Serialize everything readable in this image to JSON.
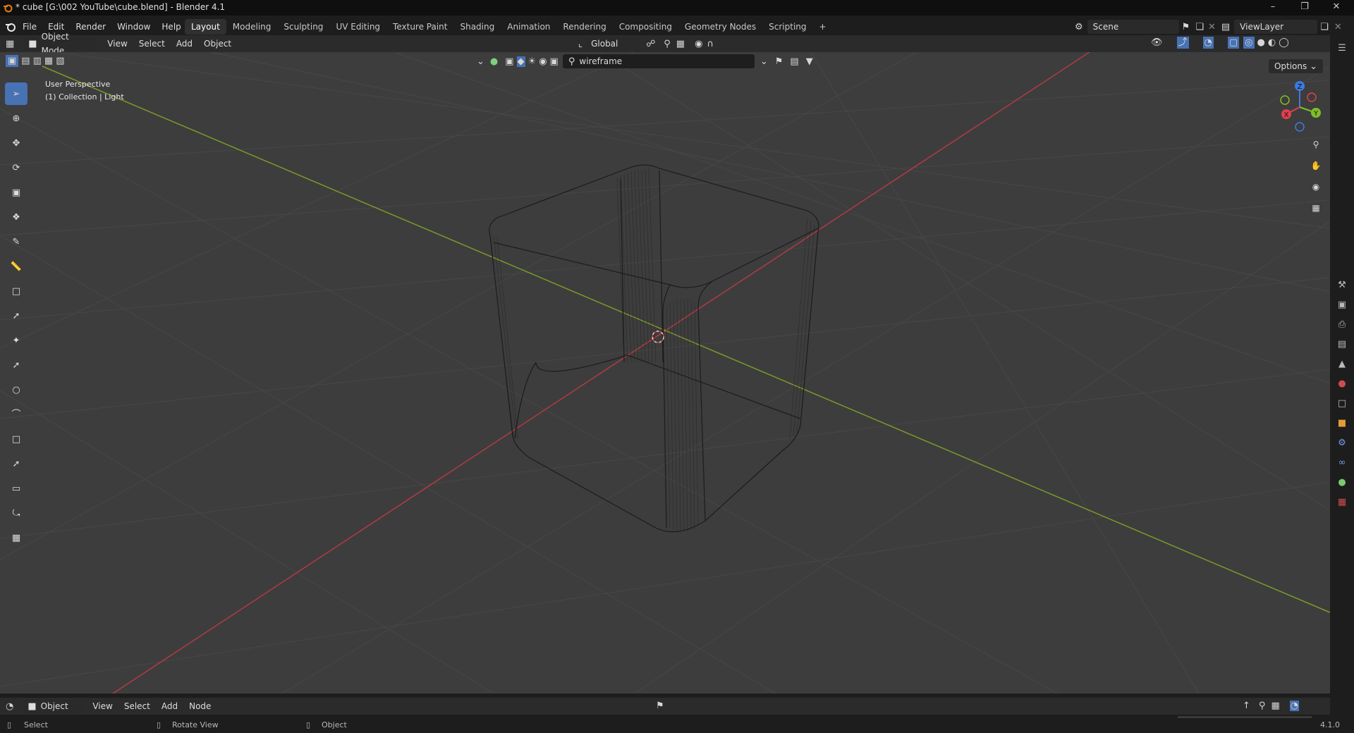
{
  "window": {
    "title": "* cube [G:\\002 YouTube\\cube.blend] - Blender 4.1"
  },
  "menu": {
    "items": [
      "File",
      "Edit",
      "Render",
      "Window",
      "Help"
    ]
  },
  "workspaces": {
    "tabs": [
      "Layout",
      "Modeling",
      "Sculpting",
      "UV Editing",
      "Texture Paint",
      "Shading",
      "Animation",
      "Rendering",
      "Compositing",
      "Geometry Nodes",
      "Scripting"
    ],
    "active": "Layout",
    "add": "+"
  },
  "scene": {
    "name": "Scene"
  },
  "view_layer": {
    "name": "ViewLayer"
  },
  "header3d": {
    "mode": "Object Mode",
    "menus": [
      "View",
      "Select",
      "Add",
      "Object"
    ],
    "orientation": "Global",
    "search_value": "wireframe",
    "options_label": "Options"
  },
  "viewport": {
    "perspective_label": "User Perspective",
    "collection_label": "(1) Collection | Light",
    "gizmo": {
      "z": "Z",
      "y": "Y",
      "x": "X"
    },
    "colors": {
      "x_axis": "#c23f4a",
      "y_axis": "#7ea02a",
      "bg": "#3d3d3d",
      "grid": "#4a4a4a"
    }
  },
  "timeline": {
    "mode": "Object",
    "menus": [
      "View",
      "Select",
      "Add",
      "Node"
    ]
  },
  "statusbar": {
    "select": "Select",
    "rotate": "Rotate View",
    "object": "Object",
    "version": "4.1.0"
  }
}
